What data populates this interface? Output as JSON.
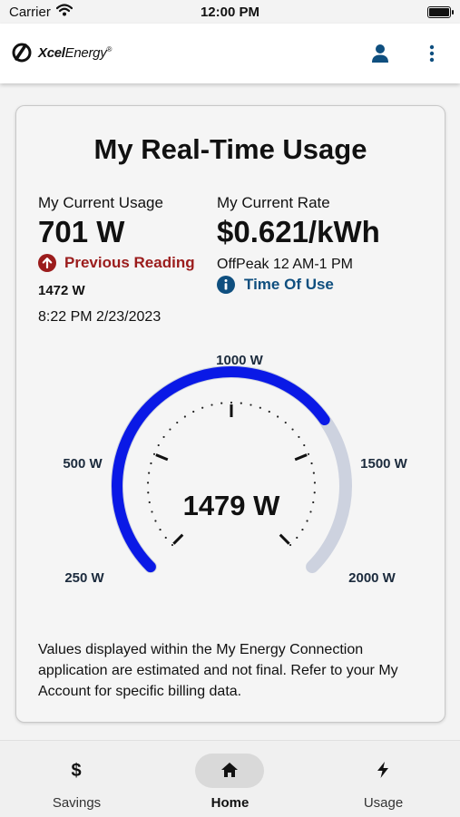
{
  "status_bar": {
    "carrier": "Carrier",
    "time": "12:00 PM"
  },
  "app_bar": {
    "brand_bold": "Xcel",
    "brand_regular": "Energy",
    "brand_mark": "®"
  },
  "card": {
    "title": "My Real-Time Usage",
    "current_usage": {
      "label": "My Current Usage",
      "value": "701 W",
      "previous_label": "Previous Reading",
      "previous_value": "1472 W",
      "previous_time": "8:22 PM 2/23/2023"
    },
    "current_rate": {
      "label": "My Current Rate",
      "value": "$0.621/kWh",
      "period": "OffPeak 12 AM-1 PM",
      "tou_label": "Time Of Use"
    },
    "gauge": {
      "center_value": "1479 W",
      "tick_labels": [
        "250 W",
        "500 W",
        "1000 W",
        "1500 W",
        "2000 W"
      ],
      "min": 250,
      "max": 2000,
      "value": 1479,
      "fill_color": "#0a19e6",
      "track_color": "#cdd2df"
    },
    "disclaimer": "Values displayed within the My Energy Connection application are estimated and not final. Refer to your My Account for specific billing data."
  },
  "tabs": [
    {
      "label": "Savings",
      "icon": "dollar-icon",
      "glyph": "$"
    },
    {
      "label": "Home",
      "icon": "home-icon",
      "glyph": ""
    },
    {
      "label": "Usage",
      "icon": "bolt-icon",
      "glyph": ""
    }
  ],
  "colors": {
    "previous_reading": "#9b1c1c",
    "time_of_use": "#0f4f7f",
    "icon_blue": "#0f4f7f"
  }
}
